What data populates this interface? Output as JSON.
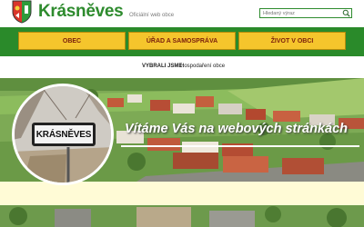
{
  "header": {
    "site_name": "Krásněves",
    "site_subtitle": "Oficiální web obce",
    "search": {
      "placeholder": "Hledaný výraz",
      "icon": "magnifier-icon"
    }
  },
  "nav": {
    "items": [
      {
        "label": "OBEC"
      },
      {
        "label": "ÚŘAD A SAMOSPRÁVA"
      },
      {
        "label": "ŽIVOT V OBCI"
      }
    ]
  },
  "breadcrumb": {
    "label": "VYBRALI JSME:",
    "separator": "-",
    "current": "Hospodaření obce"
  },
  "hero": {
    "welcome": "Vítáme Vás na webových stránkách",
    "sign_text": "KRÁSNĚVES"
  },
  "colors": {
    "brand_green": "#2a8a2a",
    "button_yellow": "#f5c52c",
    "button_text": "#7a1e0c",
    "band": "#fffbd6"
  }
}
